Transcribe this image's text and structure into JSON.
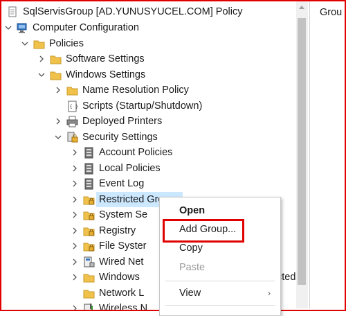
{
  "tree": {
    "root": {
      "label": "SqlServisGroup [AD.YUNUSYUCEL.COM] Policy",
      "icon": "policy-scroll-icon"
    },
    "items": [
      {
        "id": "computer-configuration",
        "label": "Computer Configuration",
        "icon": "computer-icon",
        "expander": "expanded"
      },
      {
        "id": "policies",
        "label": "Policies",
        "icon": "folder-icon",
        "expander": "expanded"
      },
      {
        "id": "software-settings",
        "label": "Software Settings",
        "icon": "folder-icon",
        "expander": "collapsed"
      },
      {
        "id": "windows-settings",
        "label": "Windows Settings",
        "icon": "folder-icon",
        "expander": "expanded"
      },
      {
        "id": "name-resolution-policy",
        "label": "Name Resolution Policy",
        "icon": "folder-icon",
        "expander": "collapsed"
      },
      {
        "id": "scripts",
        "label": "Scripts (Startup/Shutdown)",
        "icon": "script-icon",
        "expander": "none"
      },
      {
        "id": "deployed-printers",
        "label": "Deployed Printers",
        "icon": "printer-icon",
        "expander": "collapsed"
      },
      {
        "id": "security-settings",
        "label": "Security Settings",
        "icon": "security-icon",
        "expander": "expanded"
      },
      {
        "id": "account-policies",
        "label": "Account Policies",
        "icon": "policy-book-icon",
        "expander": "collapsed"
      },
      {
        "id": "local-policies",
        "label": "Local Policies",
        "icon": "policy-book-icon",
        "expander": "collapsed"
      },
      {
        "id": "event-log",
        "label": "Event Log",
        "icon": "policy-book-icon",
        "expander": "collapsed"
      },
      {
        "id": "restricted-groups",
        "label": "Restricted Groups",
        "icon": "locked-folder-icon",
        "expander": "collapsed",
        "selected": true
      },
      {
        "id": "system-services",
        "label": "System Se",
        "icon": "locked-folder-icon",
        "expander": "collapsed"
      },
      {
        "id": "registry",
        "label": "Registry",
        "icon": "locked-folder-icon",
        "expander": "collapsed"
      },
      {
        "id": "file-system",
        "label": "File Syster",
        "icon": "locked-folder-icon",
        "expander": "collapsed"
      },
      {
        "id": "wired-network",
        "label": "Wired Net",
        "icon": "network-icon",
        "expander": "collapsed"
      },
      {
        "id": "windows-firewall",
        "label": "Windows",
        "icon": "folder-icon",
        "expander": "collapsed",
        "trailing": "cted"
      },
      {
        "id": "network-list",
        "label": "Network L",
        "icon": "folder-icon",
        "expander": "none"
      },
      {
        "id": "wireless-network",
        "label": "Wireless N",
        "icon": "wireless-icon",
        "expander": "collapsed"
      }
    ]
  },
  "right_pane": {
    "header": "Grou"
  },
  "context_menu": {
    "items": [
      {
        "label": "Open",
        "bold": true
      },
      {
        "label": "Add Group...",
        "highlighted": true
      },
      {
        "label": "Copy"
      },
      {
        "label": "Paste",
        "disabled": true
      },
      {
        "label": "View",
        "submenu": true
      }
    ],
    "submenu_arrow": "›"
  },
  "colors": {
    "frame": "#e00000",
    "selection": "#cce8ff",
    "folder": "#f0c24b",
    "highlight_box": "#e00000"
  }
}
